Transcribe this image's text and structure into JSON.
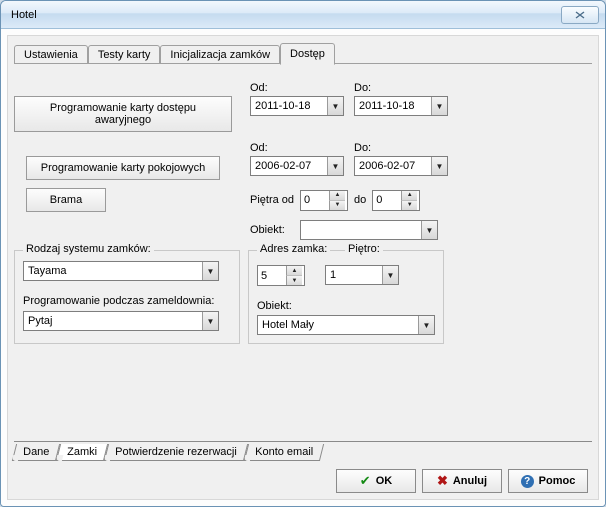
{
  "window": {
    "title": "Hotel"
  },
  "tabs_top": {
    "items": [
      "Ustawienia",
      "Testy karty",
      "Inicjalizacja zamków",
      "Dostęp"
    ],
    "active_index": 3
  },
  "buttons": {
    "prog_awaryjny": "Programowanie karty dostępu awaryjnego",
    "prog_pokojowe": "Programowanie karty pokojowych",
    "brama": "Brama"
  },
  "dates": {
    "row1": {
      "od_label": "Od:",
      "od_value": "2011-10-18",
      "do_label": "Do:",
      "do_value": "2011-10-18"
    },
    "row2": {
      "od_label": "Od:",
      "od_value": "2006-02-07",
      "do_label": "Do:",
      "do_value": "2006-02-07"
    }
  },
  "floors": {
    "pietra_od_label": "Piętra od",
    "pietra_od_value": "0",
    "do_label": "do",
    "do_value": "0"
  },
  "obiekt_top": {
    "label": "Obiekt:",
    "value": ""
  },
  "group_left": {
    "title": "Rodzaj systemu zamków:",
    "combo1_value": "Tayama",
    "label2": "Programowanie podczas zameldownia:",
    "combo2_value": "Pytaj"
  },
  "group_right": {
    "adres_label": "Adres zamka:",
    "adres_value": "5",
    "pietro_label": "Piętro:",
    "pietro_value": "1",
    "obiekt_label": "Obiekt:",
    "obiekt_value": "Hotel Mały"
  },
  "tabs_bottom": {
    "items": [
      "Dane",
      "Zamki",
      "Potwierdzenie rezerwacji",
      "Konto email"
    ],
    "active_index": 1
  },
  "footer": {
    "ok": "OK",
    "anuluj": "Anuluj",
    "pomoc": "Pomoc"
  }
}
